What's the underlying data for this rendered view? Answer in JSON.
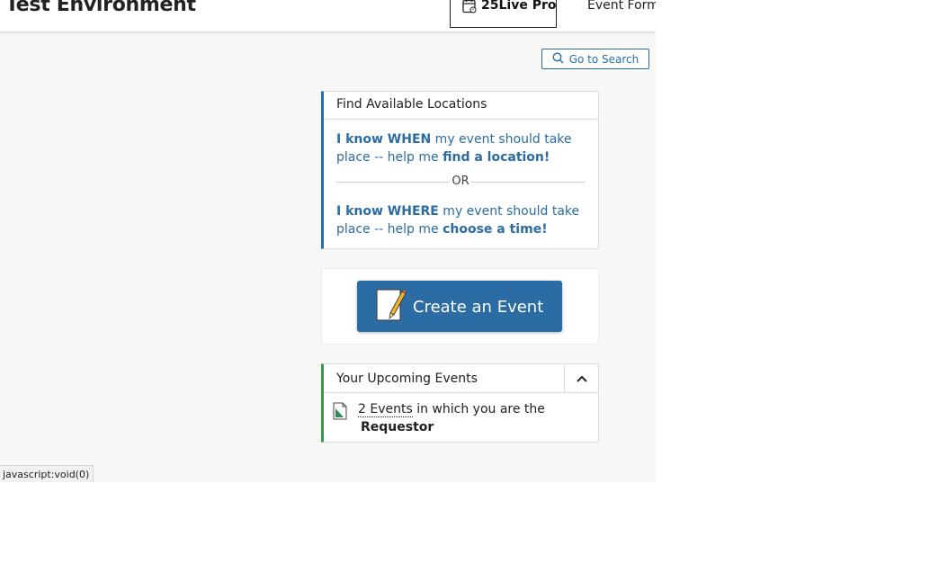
{
  "header": {
    "environment_title": "Test Environment",
    "pro_tab_label": "25Live Pro",
    "event_form_tab_label": "Event Form"
  },
  "search": {
    "go_to_search_label": "Go to Search"
  },
  "find_locations": {
    "title": "Find Available Locations",
    "when_bold": "I know WHEN",
    "when_mid": " my event should take place -- help me ",
    "when_action": "find a location!",
    "or_label": "OR",
    "where_bold": "I know WHERE",
    "where_mid": " my event should take place -- help me ",
    "where_action": "choose a time!"
  },
  "create_event": {
    "label": "Create an Event"
  },
  "upcoming": {
    "title": "Your Upcoming Events",
    "events_link": "2 Events",
    "events_text": " in which you are the",
    "role": "Requestor"
  },
  "status_bar": {
    "text": "javascript:void(0)"
  },
  "colors": {
    "accent_blue": "#2a6ca3",
    "find_border": "#1f6fb5",
    "upcoming_border": "#3a9a4a",
    "page_bg": "#f8f8f7"
  },
  "icons": [
    "calendar-icon",
    "search-icon",
    "create-event-icon",
    "chevron-up-icon",
    "document-icon"
  ]
}
